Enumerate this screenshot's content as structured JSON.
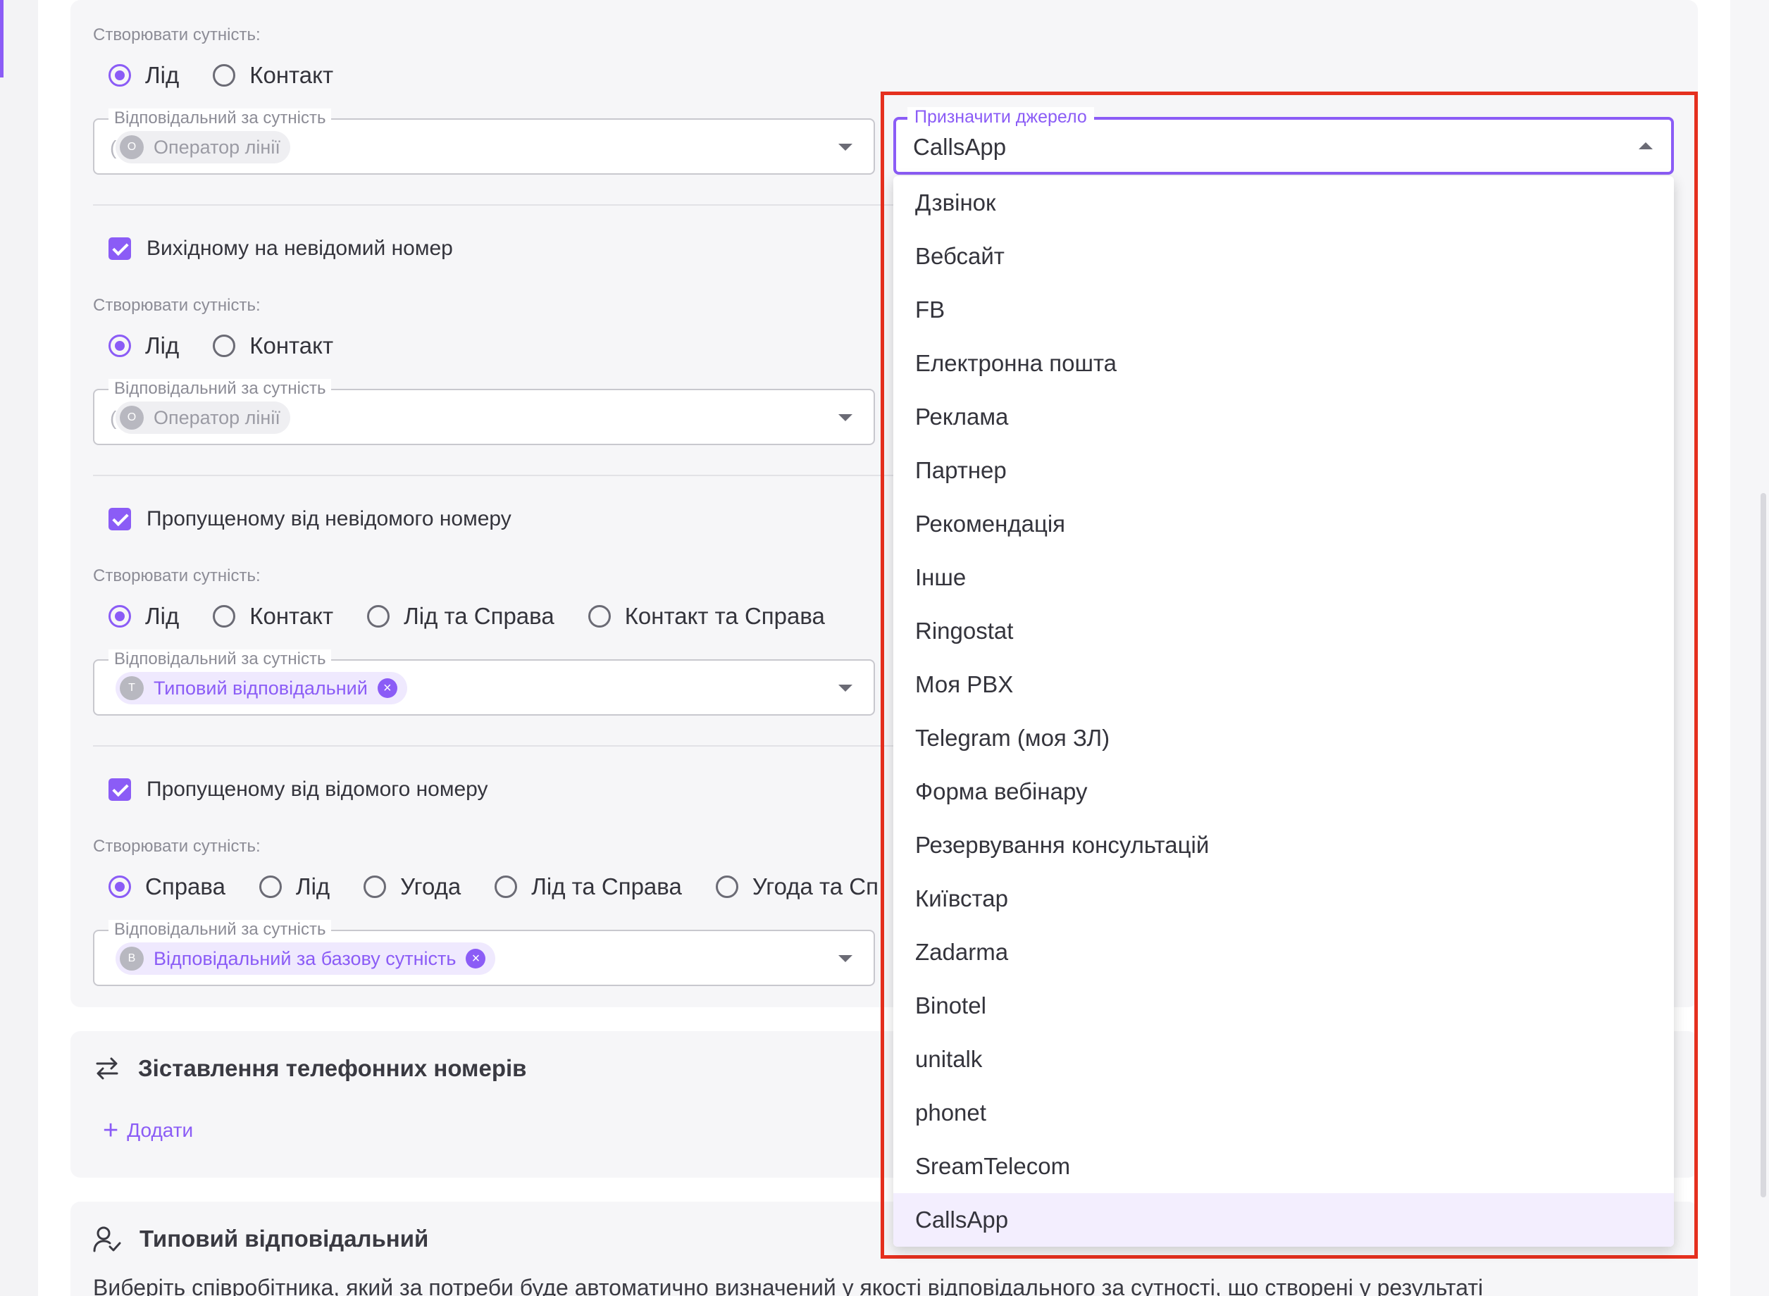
{
  "section1": {
    "create_label": "Створювати сутність:",
    "radios": [
      {
        "label": "Лід",
        "checked": true
      },
      {
        "label": "Контакт",
        "checked": false
      }
    ],
    "responsible": {
      "legend": "Відповідальний за сутність",
      "chip_initial": "О",
      "chip_label": "Оператор лінії"
    }
  },
  "section2": {
    "checkbox_label": "Вихідному на невідомий номер",
    "create_label": "Створювати сутність:",
    "radios": [
      {
        "label": "Лід",
        "checked": true
      },
      {
        "label": "Контакт",
        "checked": false
      }
    ],
    "responsible": {
      "legend": "Відповідальний за сутність",
      "chip_initial": "О",
      "chip_label": "Оператор лінії"
    }
  },
  "section3": {
    "checkbox_label": "Пропущеному від невідомого номеру",
    "create_label": "Створювати сутність:",
    "radios": [
      {
        "label": "Лід",
        "checked": true
      },
      {
        "label": "Контакт",
        "checked": false
      },
      {
        "label": "Лід та Справа",
        "checked": false
      },
      {
        "label": "Контакт та Справа",
        "checked": false
      }
    ],
    "responsible": {
      "legend": "Відповідальний за сутність",
      "chip_initial": "Т",
      "chip_label": "Типовий відповідальний"
    }
  },
  "section4": {
    "checkbox_label": "Пропущеному від відомого номеру",
    "create_label": "Створювати сутність:",
    "radios": [
      {
        "label": "Справа",
        "checked": true
      },
      {
        "label": "Лід",
        "checked": false
      },
      {
        "label": "Угода",
        "checked": false
      },
      {
        "label": "Лід та Справа",
        "checked": false
      },
      {
        "label": "Угода та Сп",
        "checked": false
      }
    ],
    "responsible": {
      "legend": "Відповідальний за сутність",
      "chip_initial": "В",
      "chip_label": "Відповідальний за базову сутність"
    }
  },
  "phones": {
    "title": "Зіставлення телефонних номерів",
    "add_label": "Додати",
    "icon": "swap-arrows-icon"
  },
  "default_responsible": {
    "title": "Типовий відповідальний",
    "icon": "user-check-icon",
    "description": "Виберіть співробітника, який за потреби буде автоматично визначений у якості відповідального за сутності, що створені у результаті"
  },
  "source_select": {
    "legend": "Призначити джерело",
    "value": "CallsApp",
    "options": [
      {
        "label": "Дзвінок"
      },
      {
        "label": "Вебсайт"
      },
      {
        "label": "FB"
      },
      {
        "label": "Електронна пошта"
      },
      {
        "label": "Реклама"
      },
      {
        "label": "Партнер"
      },
      {
        "label": "Рекомендація"
      },
      {
        "label": "Інше"
      },
      {
        "label": "Ringostat"
      },
      {
        "label": "Моя PBX"
      },
      {
        "label": "Telegram (моя ЗЛ)"
      },
      {
        "label": "Форма вебінару"
      },
      {
        "label": "Резервування консультацій"
      },
      {
        "label": "Київстар"
      },
      {
        "label": "Zadarma"
      },
      {
        "label": "Binotel"
      },
      {
        "label": "unitalk"
      },
      {
        "label": "phonet"
      },
      {
        "label": "SreamTelecom"
      },
      {
        "label": "CallsApp",
        "selected": true
      }
    ]
  },
  "colors": {
    "accent": "#8b5cf6",
    "highlight_border": "#e5301f",
    "card_bg": "#f6f6f8"
  }
}
